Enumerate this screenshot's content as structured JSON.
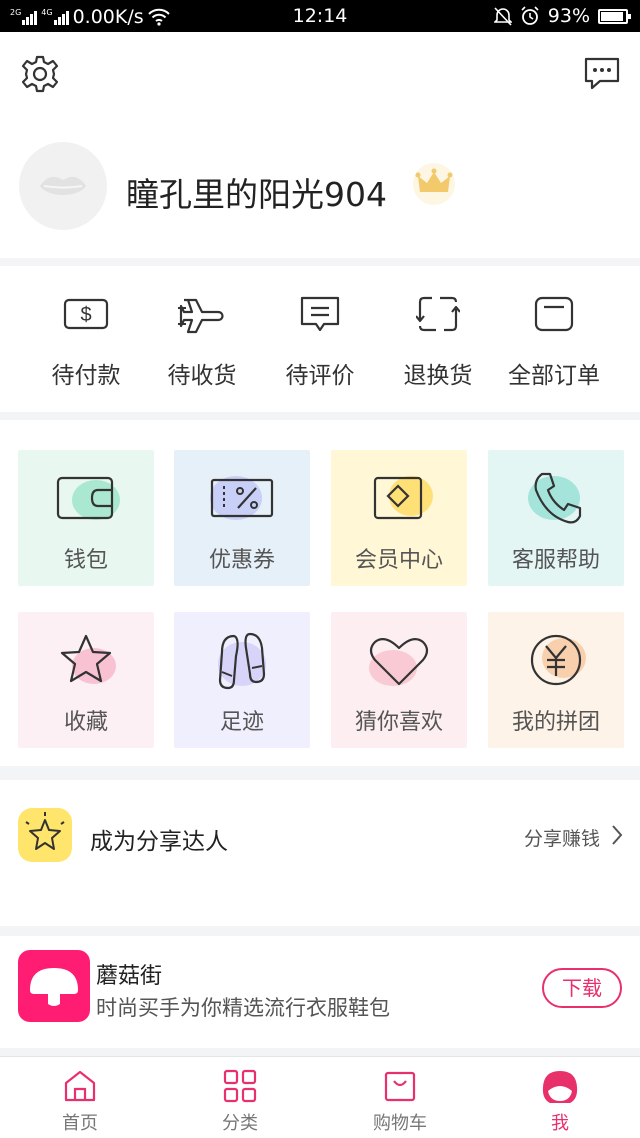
{
  "status_bar": {
    "network_left": "2G",
    "network_right": "4G",
    "speed": "0.00K/s",
    "time": "12:14",
    "battery": "93%",
    "battery_level": 0.93
  },
  "profile": {
    "username": "瞳孔里的阳光904"
  },
  "orders": [
    {
      "label": "待付款",
      "icon": "dollar-bill-icon"
    },
    {
      "label": "待收货",
      "icon": "airplane-icon"
    },
    {
      "label": "待评价",
      "icon": "comment-icon"
    },
    {
      "label": "退换货",
      "icon": "exchange-icon"
    },
    {
      "label": "全部订单",
      "icon": "orders-icon"
    }
  ],
  "tiles": [
    {
      "label": "钱包",
      "icon": "wallet-icon",
      "bg": "#e8f7f0",
      "accent": "#9be3c9"
    },
    {
      "label": "优惠券",
      "icon": "coupon-icon",
      "bg": "#e6f0f8",
      "accent": "#c0c8f6"
    },
    {
      "label": "会员中心",
      "icon": "member-icon",
      "bg": "#fff7d6",
      "accent": "#ffd95e"
    },
    {
      "label": "客服帮助",
      "icon": "phone-icon",
      "bg": "#e4f6f4",
      "accent": "#95e0d4"
    },
    {
      "label": "收藏",
      "icon": "star-icon",
      "bg": "#fdf0f4",
      "accent": "#f8b6c9"
    },
    {
      "label": "足迹",
      "icon": "footprint-icon",
      "bg": "#f0effd",
      "accent": "#cfcdf6"
    },
    {
      "label": "猜你喜欢",
      "icon": "heart-icon",
      "bg": "#fdeef1",
      "accent": "#f8c1cd"
    },
    {
      "label": "我的拼团",
      "icon": "yuan-icon",
      "bg": "#fdf3e8",
      "accent": "#f6c79d"
    }
  ],
  "share": {
    "title": "成为分享达人",
    "link": "分享赚钱"
  },
  "promo": {
    "name": "蘑菇街",
    "desc": "时尚买手为你精选流行衣服鞋包",
    "button": "下载"
  },
  "tabs": [
    {
      "label": "首页",
      "icon": "home-icon"
    },
    {
      "label": "分类",
      "icon": "category-icon"
    },
    {
      "label": "购物车",
      "icon": "cart-icon"
    },
    {
      "label": "我",
      "icon": "me-icon"
    }
  ],
  "colors": {
    "accent": "#e8306b",
    "brand": "#ff1c73"
  }
}
